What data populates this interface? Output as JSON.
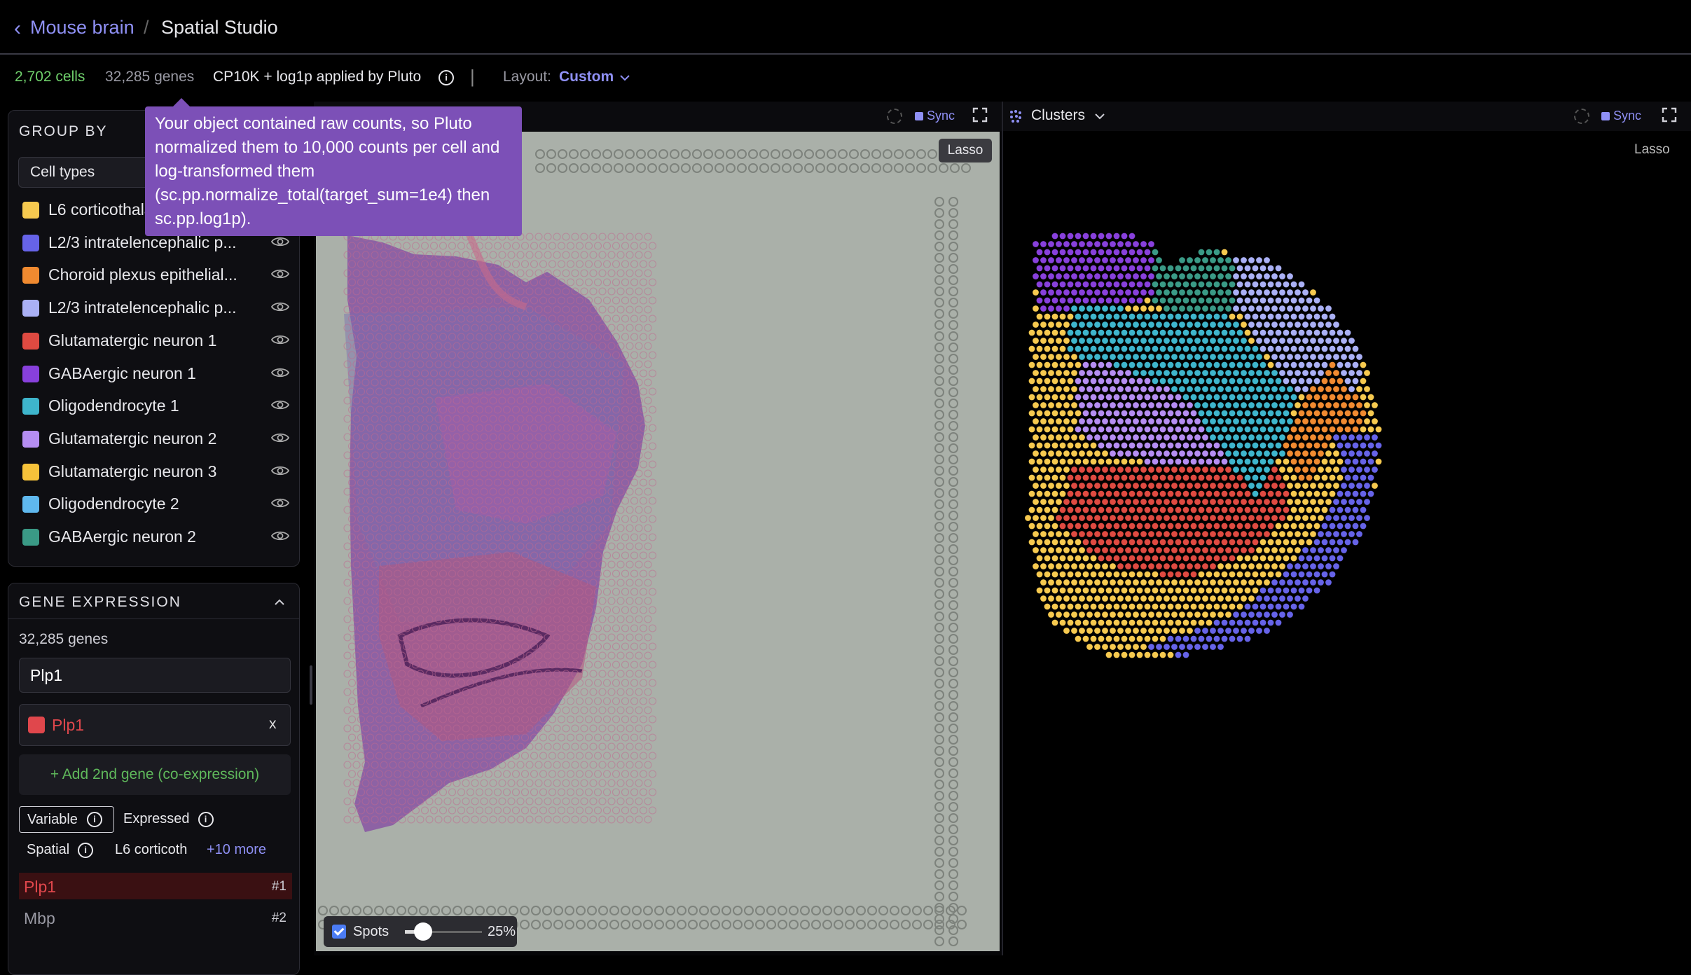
{
  "breadcrumb": {
    "back_icon": "chevron-left-icon",
    "project": "Mouse brain",
    "separator": "/",
    "current": "Spatial Studio"
  },
  "stats": {
    "cells": "2,702 cells",
    "genes": "32,285 genes",
    "normalization": "CP10K + log1p applied by Pluto",
    "divider": "|",
    "layout_label": "Layout:",
    "layout_value": "Custom",
    "layout_chevron": "⌄"
  },
  "tooltip": {
    "text": "Your object contained raw counts, so Pluto normalized them to 10,000 counts per cell and log-transformed them (sc.pp.normalize_total(target_sum=1e4) then sc.pp.log1p)."
  },
  "group_by": {
    "title": "GROUP BY",
    "select_value": "Cell types",
    "items": [
      {
        "label": "L6 corticothalamic neuron",
        "color": "#f6c94f"
      },
      {
        "label": "L2/3 intratelencephalic p...",
        "color": "#6663e8"
      },
      {
        "label": "Choroid plexus epithelial...",
        "color": "#f08a30"
      },
      {
        "label": "L2/3 intratelencephalic p...",
        "color": "#aab0f5"
      },
      {
        "label": "Glutamatergic neuron 1",
        "color": "#df4a41"
      },
      {
        "label": "GABAergic neuron 1",
        "color": "#8840dc"
      },
      {
        "label": "Oligodendrocyte 1",
        "color": "#3eb5cc"
      },
      {
        "label": "Glutamatergic neuron 2",
        "color": "#b58df2"
      },
      {
        "label": "Glutamatergic neuron 3",
        "color": "#f6c23a"
      },
      {
        "label": "Oligodendrocyte 2",
        "color": "#5fb8ee"
      },
      {
        "label": "GABAergic neuron 2",
        "color": "#3a9a86"
      }
    ]
  },
  "gene_expression": {
    "title": "GENE EXPRESSION",
    "gene_count": "32,285 genes",
    "search_value": "Plp1",
    "selected_gene": "Plp1",
    "remove_label": "x",
    "add_second": "+ Add 2nd gene (co-expression)",
    "tab_variable": "Variable",
    "tab_expressed": "Expressed",
    "sub_spatial": "Spatial",
    "sub_l6": "L6 corticoth",
    "sub_more": "+10 more",
    "ranked": [
      {
        "name": "Plp1",
        "rank": "#1"
      },
      {
        "name": "Mbp",
        "rank": "#2"
      }
    ]
  },
  "left_view": {
    "sync_label": "Sync",
    "lasso_label": "Lasso",
    "spots_label": "Spots",
    "spot_opacity": "25%"
  },
  "right_view": {
    "selector_label": "Clusters",
    "sync_label": "Sync",
    "lasso_label": "Lasso"
  },
  "colors": {
    "accent": "#8f90f5",
    "green": "#6fcf6b",
    "tooltip": "#7c50b7",
    "gene_red": "#e0474c"
  }
}
